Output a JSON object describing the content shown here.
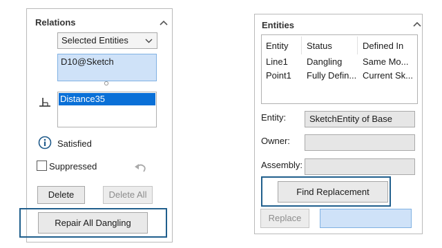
{
  "relations": {
    "title": "Relations",
    "filter_value": "Selected Entities",
    "entity_field_value": "D10@Sketch",
    "relations_list": [
      "Distance35"
    ],
    "status_text": "Satisfied",
    "suppressed_label": "Suppressed",
    "delete_label": "Delete",
    "delete_all_label": "Delete All",
    "repair_label": "Repair All Dangling"
  },
  "entities": {
    "title": "Entities",
    "columns": [
      "Entity",
      "Status",
      "Defined In"
    ],
    "rows": [
      [
        "Line1",
        "Dangling",
        "Same Mo..."
      ],
      [
        "Point1",
        "Fully Defin...",
        "Current Sk..."
      ]
    ],
    "entity_label": "Entity:",
    "entity_value": "SketchEntity of Base",
    "owner_label": "Owner:",
    "owner_value": "",
    "assembly_label": "Assembly:",
    "assembly_value": "",
    "find_replacement_label": "Find Replacement",
    "replace_label": "Replace",
    "replace_target_value": ""
  },
  "colors": {
    "selection": "#0a70d7",
    "field_blue": "#cfe2f8",
    "focus_frame": "#1f5e8c",
    "info_icon": "#1f5a8a"
  }
}
